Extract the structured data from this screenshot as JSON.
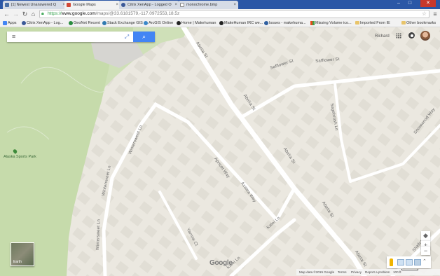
{
  "browser": {
    "tabs": [
      {
        "label": "[1] Newest Unanswered Q",
        "active": false,
        "icon_color": "#4a6fa5"
      },
      {
        "label": "Google Maps",
        "active": true,
        "icon_color": "#d14836"
      },
      {
        "label": "Citrix XenApp - Logged O",
        "active": false,
        "icon_color": "#3b5998"
      },
      {
        "label": "monochrome.bmp",
        "active": false,
        "icon_color": "#888888"
      }
    ],
    "url_scheme": "https://",
    "url_host": "www.google.com",
    "url_path": "/maps/@33.6181579,-117.0972553,18.5z",
    "bookmarks": [
      {
        "label": "Apps",
        "icon": "apps-icon",
        "color": "#4285f4"
      },
      {
        "label": "Citrix XenApp - Log...",
        "icon": "citrix-icon",
        "color": "#3b5998"
      },
      {
        "label": "GeoNet Recent",
        "icon": "geonet-icon",
        "color": "#2a8c3f"
      },
      {
        "label": "Stack Exchange GIS",
        "icon": "stackexchange-icon",
        "color": "#2f7ab0"
      },
      {
        "label": "ArcGIS Online",
        "icon": "arcgis-icon",
        "color": "#3a87c8"
      },
      {
        "label": "Home | Makehuman",
        "icon": "makehuman-icon",
        "color": "#222222"
      },
      {
        "label": "MakeHuman IRC we...",
        "icon": "irc-icon",
        "color": "#222222"
      },
      {
        "label": "Issues - makehuma...",
        "icon": "issues-icon",
        "color": "#2f5fa0"
      },
      {
        "label": "Missing Volume ico...",
        "icon": "windows-icon",
        "color": "#e64a19"
      },
      {
        "label": "Imported From IE",
        "icon": "folder-icon",
        "color": "#e8c46a"
      },
      {
        "label": "Other bookmarks",
        "icon": "folder-icon",
        "color": "#e8c46a"
      }
    ]
  },
  "map": {
    "account_name": "Richard",
    "streets": [
      {
        "label": "Abelia St"
      },
      {
        "label": "Safflower St"
      },
      {
        "label": "Safflower St"
      },
      {
        "label": "Abelia St"
      },
      {
        "label": "Sagebrush Ln"
      },
      {
        "label": "Snowwood Way"
      },
      {
        "label": "Abelia St"
      },
      {
        "label": "Wintersweet Ln"
      },
      {
        "label": "Wintersweet Ln"
      },
      {
        "label": "Wintersweet Ln"
      },
      {
        "label": "Apricot Way"
      },
      {
        "label": "Azalea Way"
      },
      {
        "label": "Abelia St"
      },
      {
        "label": "Kalei Ln"
      },
      {
        "label": "Yarrow Ct"
      },
      {
        "label": "Kalei Ln"
      },
      {
        "label": "Abelia St"
      },
      {
        "label": "Shallot Dr"
      }
    ],
    "park_label": "Alaska Sports Park",
    "earth_label": "Earth",
    "logo_text": "Google",
    "footer": {
      "data": "Map data ©2015 Google",
      "terms": "Terms",
      "privacy": "Privacy",
      "report": "Report a problem",
      "scale": "100 ft"
    },
    "colors": {
      "land": "#ebe8e0",
      "park": "#cfe0b8",
      "road": "#ffffff",
      "building": "#e0ddd4",
      "search_blue": "#4285f4"
    }
  }
}
